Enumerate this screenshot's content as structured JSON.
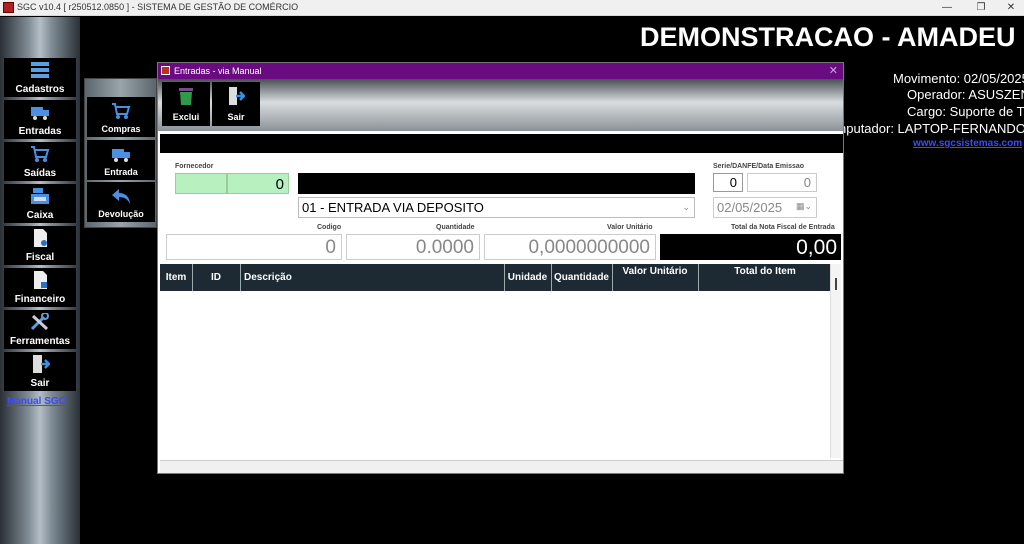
{
  "window": {
    "title": "SGC v10.4 [ r250512.0850 ] - SISTEMA DE GESTÃO DE COMÉRCIO",
    "minimize": "—",
    "maximize": "❐",
    "close": "✕"
  },
  "sidebar": {
    "items": [
      {
        "label": "Cadastros",
        "icon": "list-icon"
      },
      {
        "label": "Entradas",
        "icon": "truck-icon"
      },
      {
        "label": "Saídas",
        "icon": "cart-icon"
      },
      {
        "label": "Caixa",
        "icon": "cash-register-icon"
      },
      {
        "label": "Fiscal",
        "icon": "document-icon"
      },
      {
        "label": "Financeiro",
        "icon": "document-icon"
      },
      {
        "label": "Ferramentas",
        "icon": "tools-icon"
      },
      {
        "label": "Sair",
        "icon": "exit-door-icon"
      }
    ],
    "manual_link": "Manual SGC"
  },
  "submenu": {
    "items": [
      {
        "label": "Compras",
        "icon": "cart-icon"
      },
      {
        "label": "Entrada",
        "icon": "truck-icon"
      },
      {
        "label": "Devolução",
        "icon": "return-arrow-icon"
      }
    ]
  },
  "header": {
    "company": "DEMONSTRACAO - AMADEU",
    "movimento": "Movimento: 02/05/2025",
    "operador": "Operador: ASUSZEN",
    "cargo": "Cargo: Suporte de T",
    "computador": "nputador: LAPTOP-FERNANDO",
    "website": "www.sgcsistemas.com"
  },
  "dialog": {
    "title": "Entradas - via Manual",
    "close": "✕",
    "toolbar": {
      "exclui": "Exclui",
      "sair": "Sair"
    },
    "fornecedor_label": "Fornecedor",
    "fornecedor_code": "0",
    "serie_label": "Serie/DANFE/Data Emissao",
    "serie_value": "0",
    "danfe_value": "0",
    "tipo_entrada": "01 - ENTRADA VIA DEPOSITO",
    "data_emissao": "02/05/2025",
    "codigo_label": "Codigo",
    "codigo_value": "0",
    "quantidade_label": "Quantidade",
    "quantidade_value": "0.0000",
    "valor_unitario_label": "Valor Unitário",
    "valor_unitario_value": "0,0000000000",
    "total_nf_label": "Total da Nota Fiscal de Entrada",
    "total_nf_value": "0,00",
    "grid_columns": {
      "item": "Item",
      "id": "ID",
      "descricao": "Descrição",
      "unidade": "Unidade",
      "quantidade": "Quantidade",
      "valor_unitario": "Valor Unitário",
      "total_item": "Total do Item"
    }
  },
  "colors": {
    "dialog_titlebar": "#6b0b82",
    "fornecedor_field": "#b8f0c0",
    "link": "#3a4cff"
  }
}
